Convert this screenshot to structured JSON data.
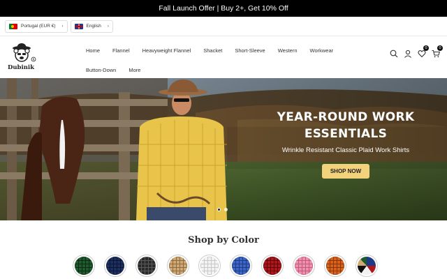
{
  "announcement": "Fall Launch Offer | Buy 2+, Get 10% Off",
  "locale": {
    "country": "Portugal (EUR €)",
    "language": "English"
  },
  "brand": "Dubinik",
  "nav": {
    "row1": [
      "Home",
      "Flannel",
      "Heavyweight Flannel",
      "Shacket",
      "Short-Sleeve",
      "Western",
      "Workwear"
    ],
    "row2": [
      "Button-Down",
      "More"
    ]
  },
  "icons": {
    "wishlist_count": "0",
    "cart_count": "0"
  },
  "hero": {
    "title_line1": "YEAR-ROUND WORK",
    "title_line2": "ESSENTIALS",
    "subtitle": "Wrinkle Resistant Classic Plaid Work Shirts",
    "button": "SHOP NOW"
  },
  "shop_by_color": {
    "title": "Shop by Color",
    "swatches": [
      {
        "name": "green",
        "color": "#1f5a2e",
        "line": "#0d2b14"
      },
      {
        "name": "navy",
        "color": "#1c2f5e",
        "line": "#0b1430"
      },
      {
        "name": "black",
        "color": "#2a2a2a",
        "line": "#5a5a5a"
      },
      {
        "name": "khaki",
        "color": "#cfa874",
        "line": "#8a6a40"
      },
      {
        "name": "white",
        "color": "#f2f2f2",
        "line": "#c8c8c8"
      },
      {
        "name": "blue",
        "color": "#3d66c4",
        "line": "#1c3a85"
      },
      {
        "name": "red",
        "color": "#b0151c",
        "line": "#5a0508"
      },
      {
        "name": "pink",
        "color": "#ee8fae",
        "line": "#c25a7c"
      },
      {
        "name": "orange",
        "color": "#d8621a",
        "line": "#8a3606"
      },
      {
        "name": "multi",
        "color": "#1c3a85",
        "line": "#111"
      }
    ]
  }
}
